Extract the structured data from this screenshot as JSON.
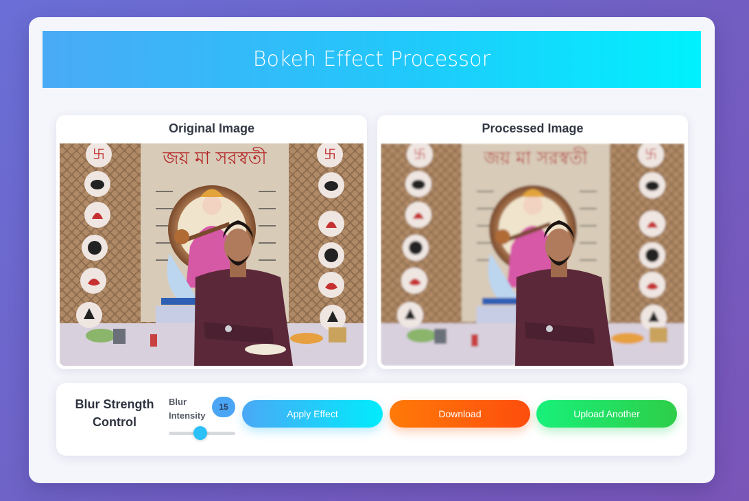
{
  "header": {
    "title": "Bokeh Effect Processor"
  },
  "panels": {
    "original": {
      "title": "Original Image"
    },
    "processed": {
      "title": "Processed Image"
    }
  },
  "photo": {
    "banner_text": "জয় মা সরস্বতী"
  },
  "controls": {
    "title": "Blur Strength Control",
    "slider_label": "Blur Intensity",
    "slider_value": "15",
    "slider_fraction": 0.47
  },
  "buttons": {
    "apply": "Apply Effect",
    "download": "Download",
    "upload": "Upload Another"
  },
  "colors": {
    "banner_start": "#4aaaf6",
    "banner_end": "#00f1fe",
    "apply": "#21c8fb",
    "download": "#fd5a0d",
    "upload": "#22dc5e"
  }
}
